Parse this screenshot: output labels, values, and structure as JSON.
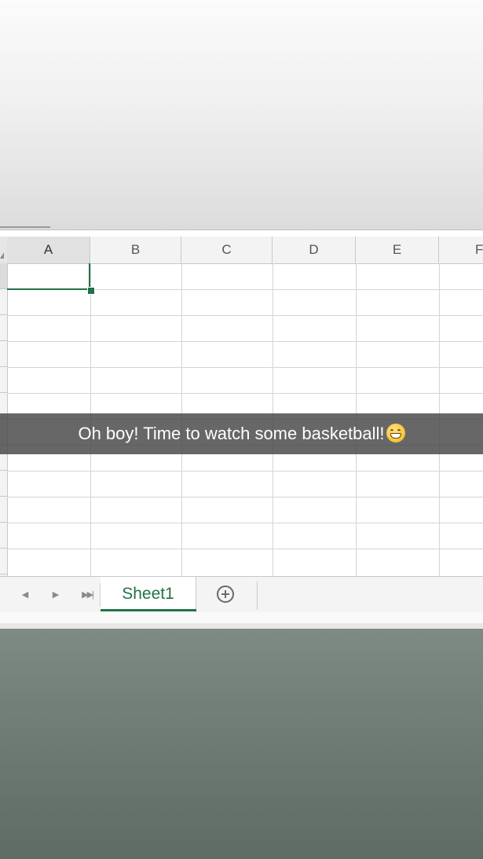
{
  "spreadsheet": {
    "columns": [
      "A",
      "B",
      "C",
      "D",
      "E",
      "F"
    ],
    "selected_column": "A",
    "sheet_tab_label": "Sheet1",
    "colors": {
      "accent": "#217346",
      "grid_line": "#d4d4d4",
      "header_bg": "#f3f3f3"
    }
  },
  "caption": {
    "text": "Oh boy! Time to watch some basketball!",
    "emoji": "grinning-face"
  },
  "icons": {
    "nav_prev": "chevron-left-icon",
    "nav_next": "chevron-right-icon",
    "nav_last": "skip-last-icon",
    "add_sheet": "plus-circle-icon"
  }
}
